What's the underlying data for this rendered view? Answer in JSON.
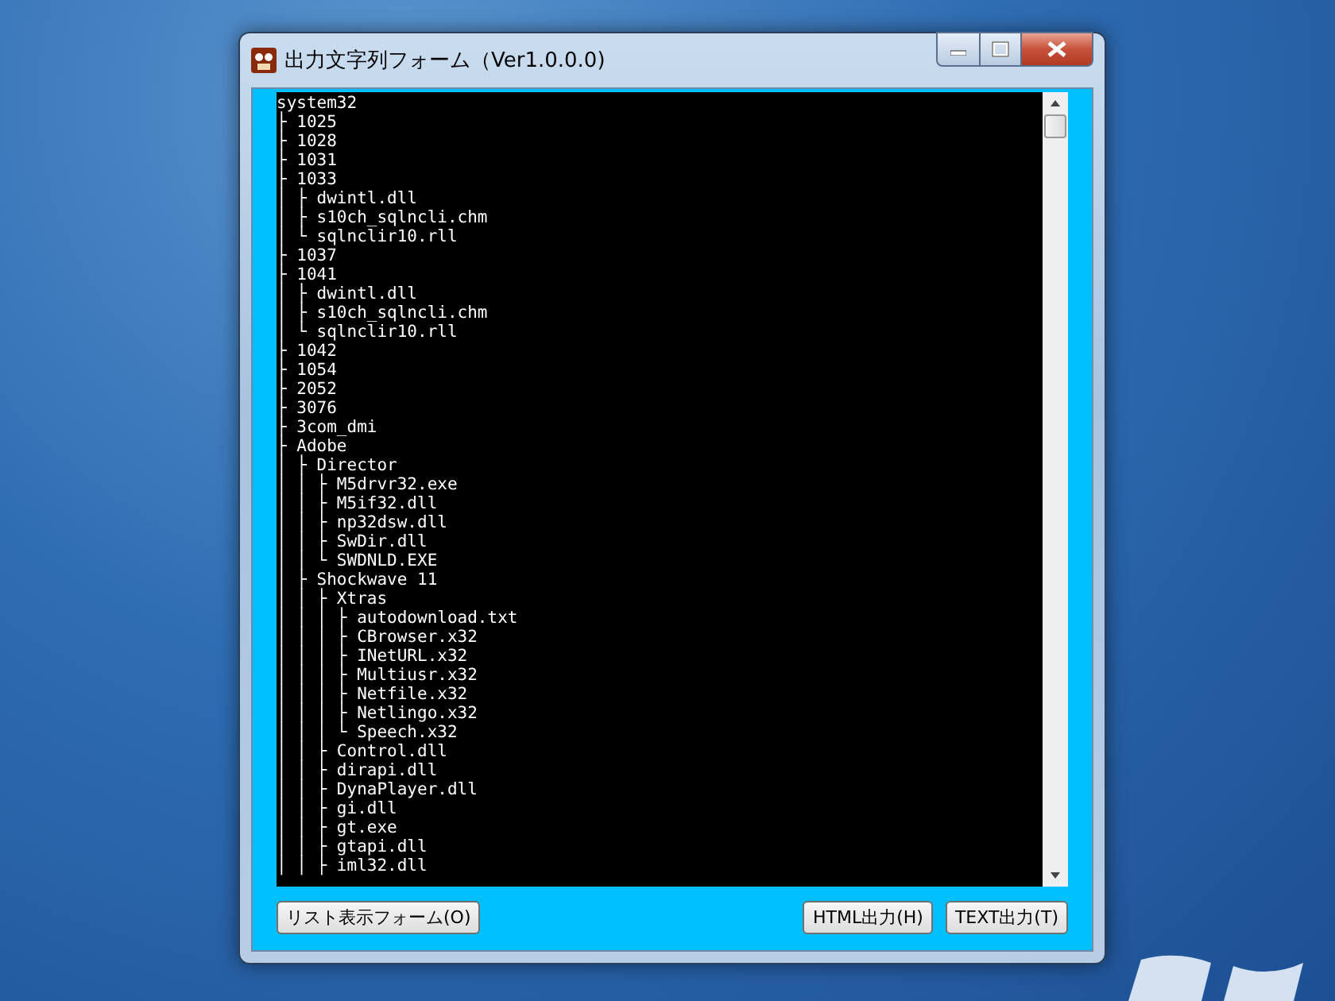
{
  "window": {
    "title": "出力文字列フォーム（Ver1.0.0.0)"
  },
  "output": {
    "lines": [
      "system32",
      "├ 1025",
      "├ 1028",
      "├ 1031",
      "├ 1033",
      "│ ├ dwintl.dll",
      "│ ├ s10ch_sqlncli.chm",
      "│ └ sqlnclir10.rll",
      "├ 1037",
      "├ 1041",
      "│ ├ dwintl.dll",
      "│ ├ s10ch_sqlncli.chm",
      "│ └ sqlnclir10.rll",
      "├ 1042",
      "├ 1054",
      "├ 2052",
      "├ 3076",
      "├ 3com_dmi",
      "├ Adobe",
      "│ ├ Director",
      "│ │ ├ M5drvr32.exe",
      "│ │ ├ M5if32.dll",
      "│ │ ├ np32dsw.dll",
      "│ │ ├ SwDir.dll",
      "│ │ └ SWDNLD.EXE",
      "│ ├ Shockwave 11",
      "│ │ ├ Xtras",
      "│ │ │ ├ autodownload.txt",
      "│ │ │ ├ CBrowser.x32",
      "│ │ │ ├ INetURL.x32",
      "│ │ │ ├ Multiusr.x32",
      "│ │ │ ├ Netfile.x32",
      "│ │ │ ├ Netlingo.x32",
      "│ │ │ └ Speech.x32",
      "│ │ ├ Control.dll",
      "│ │ ├ dirapi.dll",
      "│ │ ├ DynaPlayer.dll",
      "│ │ ├ gi.dll",
      "│ │ ├ gt.exe",
      "│ │ ├ gtapi.dll",
      "│ │ ├ iml32.dll"
    ]
  },
  "buttons": [
    {
      "label": "リスト表示フォーム(O)",
      "kind": "left"
    },
    {
      "label": "HTML出力(H)",
      "kind": "right"
    },
    {
      "label": "TEXT出力(T)",
      "kind": "right"
    }
  ]
}
